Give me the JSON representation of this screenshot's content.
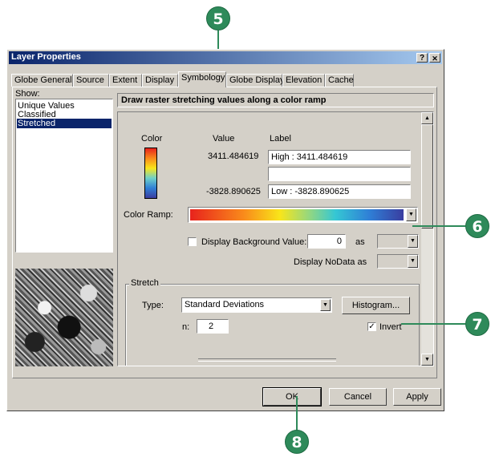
{
  "dialog": {
    "title": "Layer Properties",
    "help_button": "?",
    "close_button": "✕",
    "tabs": [
      "Globe General",
      "Source",
      "Extent",
      "Display",
      "Symbology",
      "Globe Display",
      "Elevation",
      "Cache"
    ],
    "active_tab": "Symbology"
  },
  "show": {
    "label": "Show:",
    "items": [
      "Unique Values",
      "Classified",
      "Stretched"
    ],
    "selected": "Stretched"
  },
  "header": {
    "description": "Draw raster stretching values along a color ramp"
  },
  "symbology": {
    "color_header": "Color",
    "value_header": "Value",
    "label_header": "Label",
    "high_value": "3411.484619",
    "high_label": "High : 3411.484619",
    "mid_label": "",
    "low_value": "-3828.890625",
    "low_label": "Low : -3828.890625",
    "color_ramp_label": "Color Ramp:",
    "display_background_label": "Display Background Value:",
    "display_background_checked": false,
    "background_value": "0",
    "as_label": "as",
    "display_nodata_label": "Display NoData as"
  },
  "stretch": {
    "group_label": "Stretch",
    "type_label": "Type:",
    "type_value": "Standard Deviations",
    "histogram_button": "Histogram...",
    "n_label": "n:",
    "n_value": "2",
    "invert_label": "Invert",
    "invert_checked": true,
    "check_mark": "✓"
  },
  "buttons": {
    "ok": "OK",
    "cancel": "Cancel",
    "apply": "Apply"
  },
  "callouts": [
    "5",
    "6",
    "7",
    "8"
  ],
  "icons": {
    "scroll_up": "▲",
    "scroll_down": "▼",
    "dropdown": "▼"
  }
}
